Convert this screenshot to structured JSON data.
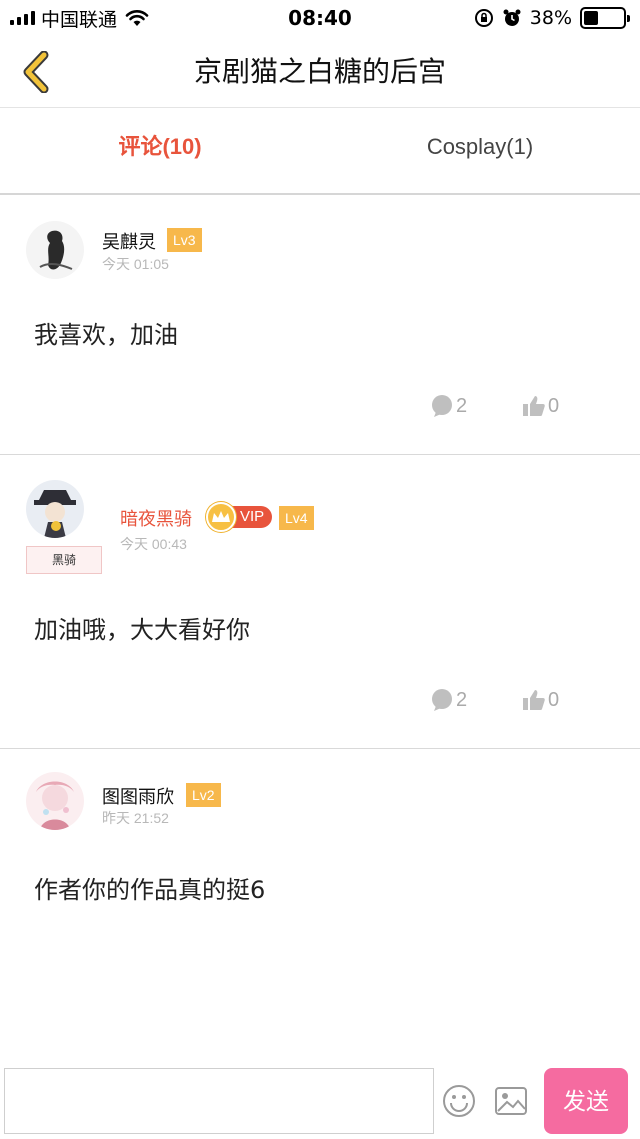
{
  "status_bar": {
    "carrier": "中国联通",
    "time": "08:40",
    "battery": "38%",
    "battery_level": 0.38,
    "icons": [
      "signal-icon",
      "wifi-icon",
      "rotation-lock-icon",
      "alarm-icon",
      "battery-icon"
    ]
  },
  "nav": {
    "title": "京剧猫之白糖的后宫",
    "back_icon": "chevron-left-icon",
    "accent": "#f2c33a"
  },
  "tabs": [
    {
      "label": "评论(10)",
      "active": true
    },
    {
      "label": "Cosplay(1)",
      "active": false
    }
  ],
  "comments": [
    {
      "username": "吴麒灵",
      "level": "Lv3",
      "time": "今天 01:05",
      "content": "我喜欢，加油",
      "reply_count": "2",
      "like_count": "0"
    },
    {
      "username": "暗夜黑骑",
      "vip_label": "VIP",
      "level": "Lv4",
      "time": "今天 00:43",
      "nameplate": "黑骑",
      "content": "加油哦，大大看好你",
      "reply_count": "2",
      "like_count": "0"
    },
    {
      "username": "图图雨欣",
      "level": "Lv2",
      "time": "昨天 21:52",
      "content": "作者你的作品真的挺6"
    }
  ],
  "input_bar": {
    "placeholder": "",
    "send_label": "发送",
    "emoji_icon": "smiley-icon",
    "image_icon": "image-icon"
  },
  "colors": {
    "accent_red": "#e8543c",
    "level_badge": "#f7b84b",
    "send_button": "#f56ba0"
  }
}
